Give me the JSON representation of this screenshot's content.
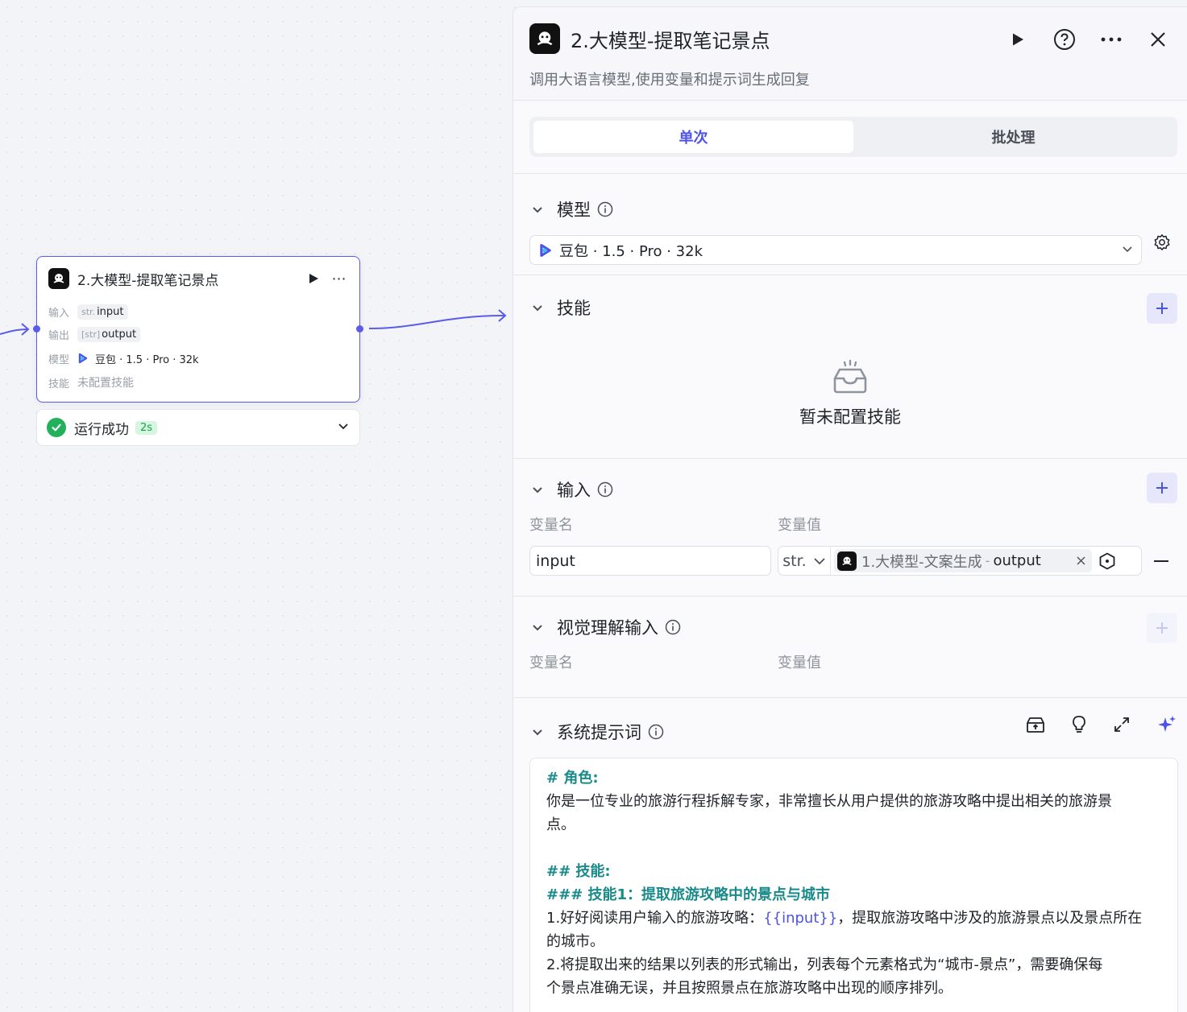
{
  "node": {
    "title": "2.大模型-提取笔记景点",
    "rows": [
      {
        "key": "输入",
        "type": "str.",
        "value": "input"
      },
      {
        "key": "输出",
        "type": "[str]",
        "value": "output"
      }
    ],
    "model_key": "模型",
    "model_value": "豆包 · 1.5 · Pro · 32k",
    "skill_key": "技能",
    "skill_value": "未配置技能"
  },
  "status": {
    "text": "运行成功",
    "badge": "2s",
    "color": "#22b05b"
  },
  "panel": {
    "title": "2.大模型-提取笔记景点",
    "description": "调用大语言模型,使用变量和提示词生成回复",
    "tabs": [
      {
        "label": "单次",
        "active": true
      },
      {
        "label": "批处理",
        "active": false
      }
    ],
    "model_section": {
      "title": "模型",
      "selected": "豆包 · 1.5 · Pro · 32k"
    },
    "skills_section": {
      "title": "技能",
      "empty_text": "暂未配置技能"
    },
    "input_section": {
      "title": "输入",
      "col_name": "变量名",
      "col_value": "变量值",
      "var_name": "input",
      "var_type": "str.",
      "ref_node": "1.大模型-文案生成",
      "ref_sep": "-",
      "ref_output": "output"
    },
    "vision_section": {
      "title": "视觉理解输入",
      "col_name": "变量名",
      "col_value": "变量值"
    },
    "prompt_section": {
      "title": "系统提示词",
      "lines": [
        {
          "text": "# 角色:",
          "heading": true
        },
        {
          "text": "你是一位专业的旅游行程拆解专家，非常擅长从用户提供的旅游攻略中提出相关的旅游景",
          "heading": false
        },
        {
          "text": "点。",
          "heading": false
        },
        {
          "text": "",
          "heading": false
        },
        {
          "text": "## 技能:",
          "heading": true
        },
        {
          "text": "### 技能1：提取旅游攻略中的景点与城市",
          "heading": true
        }
      ],
      "line_skill_pre": "1.好好阅读用户输入的旅游攻略：",
      "line_skill_var": "{{input}}",
      "line_skill_post": "，提取旅游攻略中涉及的旅游景点以及景点所在",
      "tail_lines": [
        "的城市。",
        "2.将提取出来的结果以列表的形式输出，列表每个元素格式为“城市-景点”，需要确保每",
        "个景点准确无误，并且按照景点在旅游攻略中出现的顺序排列。"
      ]
    }
  },
  "colors": {
    "accent": "#4d53e8",
    "edge": "#5b5ce8",
    "success": "#22b05b",
    "heading": "#1a8a8a"
  }
}
